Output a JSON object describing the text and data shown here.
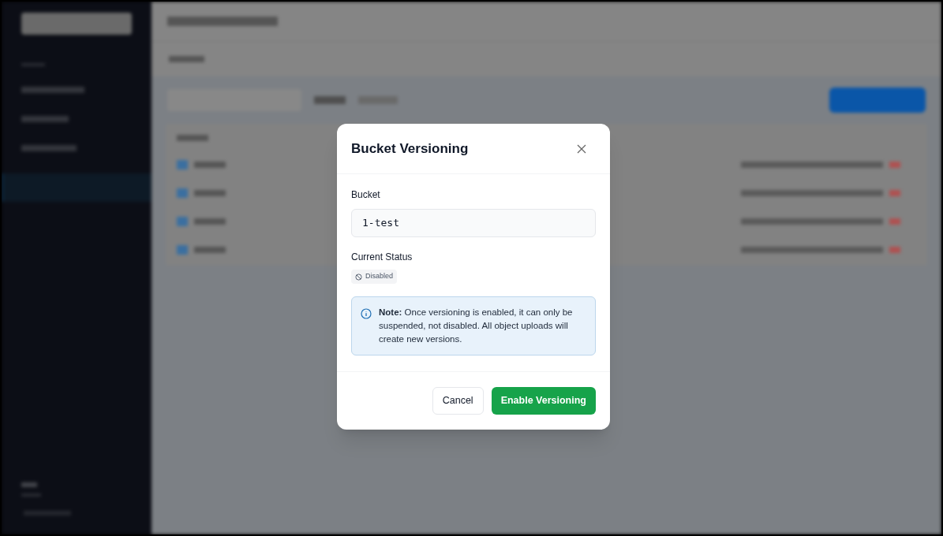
{
  "dialog": {
    "title": "Bucket Versioning",
    "bucket_label": "Bucket",
    "bucket_value": "1-test",
    "status_label": "Current Status",
    "status": {
      "label": "Disabled",
      "kind": "disabled"
    },
    "note": "**Note:** Once versioning is enabled, it can only be suspended, not disabled. All object uploads will create new versions.",
    "buttons": [
      {
        "label": "Cancel",
        "kind": "secondary"
      },
      {
        "label": "Enable Versioning",
        "kind": "primary"
      }
    ]
  }
}
